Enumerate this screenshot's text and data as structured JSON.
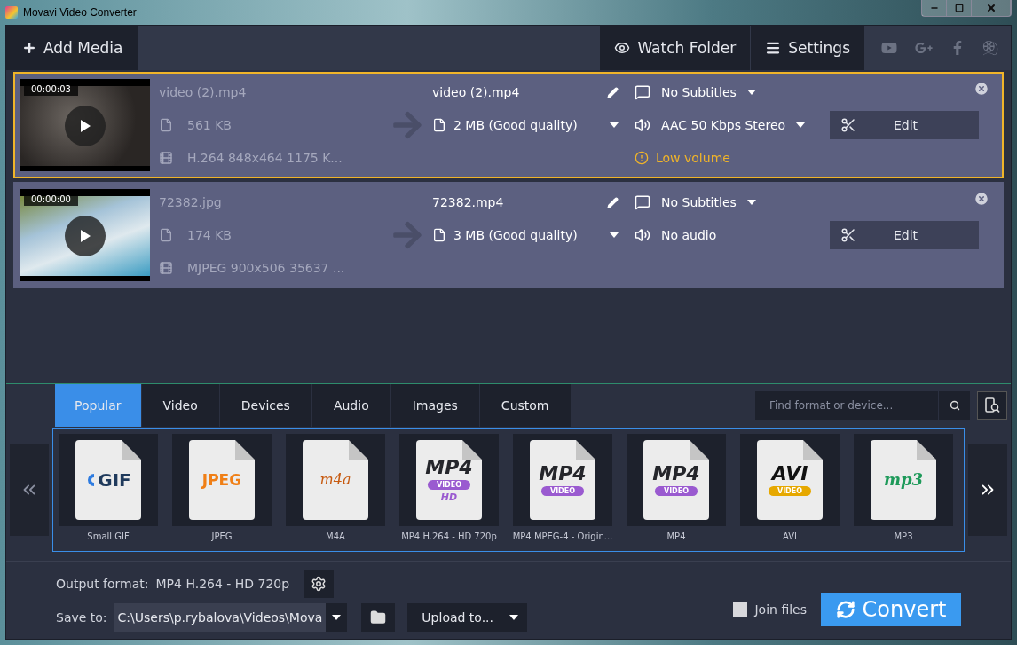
{
  "window": {
    "title": "Movavi Video Converter"
  },
  "toolbar": {
    "add_media": "Add Media",
    "watch_folder": "Watch Folder",
    "settings": "Settings"
  },
  "files": [
    {
      "selected": true,
      "duration": "00:00:03",
      "source_name": "video (2).mp4",
      "source_size": "561 KB",
      "source_info": "H.264 848x464 1175 K...",
      "output_name": "video (2).mp4",
      "output_size": "2 MB (Good quality)",
      "subtitles": "No Subtitles",
      "audio": "AAC 50 Kbps Stereo",
      "audio_dropdown": true,
      "edit": "Edit",
      "warning": "Low volume"
    },
    {
      "selected": false,
      "duration": "00:00:00",
      "source_name": "72382.jpg",
      "source_size": "174 KB",
      "source_info": "MJPEG 900x506 35637 ...",
      "output_name": "72382.mp4",
      "output_size": "3 MB (Good quality)",
      "subtitles": "No Subtitles",
      "audio": "No audio",
      "audio_dropdown": false,
      "edit": "Edit"
    }
  ],
  "format_tabs": [
    {
      "label": "Popular",
      "selected": true
    },
    {
      "label": "Video",
      "selected": false
    },
    {
      "label": "Devices",
      "selected": false
    },
    {
      "label": "Audio",
      "selected": false
    },
    {
      "label": "Images",
      "selected": false
    },
    {
      "label": "Custom",
      "selected": false
    }
  ],
  "search": {
    "placeholder": "Find format or device..."
  },
  "formats": [
    {
      "kind": "gif",
      "logo": "GIF",
      "label": "Small GIF"
    },
    {
      "kind": "jpeg",
      "logo": "JPEG",
      "label": "JPEG"
    },
    {
      "kind": "m4a",
      "logo": "m4a",
      "label": "M4A"
    },
    {
      "kind": "mp4",
      "logo": "MP4",
      "badge": "VIDEO",
      "extra": "HD",
      "label": "MP4 H.264 - HD 720p"
    },
    {
      "kind": "mp4",
      "logo": "MP4",
      "badge": "VIDEO",
      "label": "MP4 MPEG-4 - Origin..."
    },
    {
      "kind": "mp4",
      "logo": "MP4",
      "badge": "VIDEO",
      "label": "MP4"
    },
    {
      "kind": "avi",
      "logo": "AVI",
      "badge": "VIDEO",
      "label": "AVI"
    },
    {
      "kind": "mp3",
      "logo": "mp3",
      "label": "MP3"
    }
  ],
  "output": {
    "label": "Output format:",
    "value": "MP4 H.264 - HD 720p"
  },
  "save": {
    "label": "Save to:",
    "path": "C:\\Users\\p.rybalova\\Videos\\Mova",
    "upload": "Upload to..."
  },
  "join_files": {
    "label": "Join files",
    "checked": false
  },
  "convert": "Convert"
}
